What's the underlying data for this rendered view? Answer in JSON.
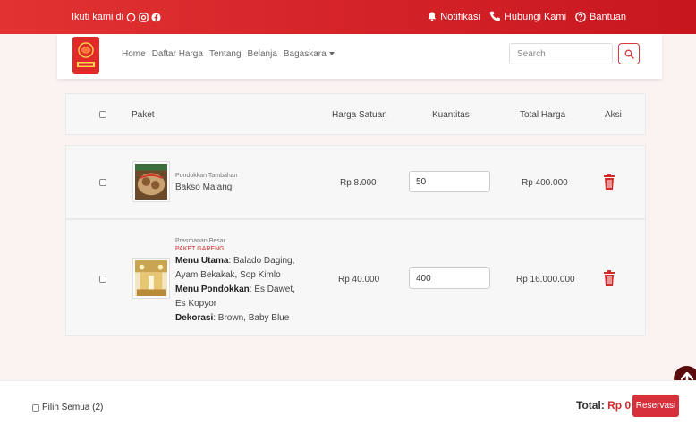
{
  "topbar": {
    "follow_text": "Ikuti kami di",
    "social_icons": [
      "whatsapp-icon",
      "instagram-icon",
      "facebook-icon"
    ],
    "notifications_label": "Notifikasi",
    "contact_label": "Hubungi Kami",
    "help_label": "Bantuan"
  },
  "navbar": {
    "logo_icon": "catering-logo",
    "links": [
      "Home",
      "Daftar Harga",
      "Tentang",
      "Belanja",
      "Bagaskara"
    ],
    "search_placeholder": "Search",
    "search_icon": "search-icon"
  },
  "table": {
    "headers": {
      "package": "Paket",
      "unit_price": "Harga Satuan",
      "quantity": "Kuantitas",
      "total_price": "Total Harga",
      "action": "Aksi"
    },
    "rows": [
      {
        "category": "Pondokkan Tambahan",
        "name": "Bakso Malang",
        "unit_price": "Rp 8.000",
        "quantity": "50",
        "total": "Rp 400.000",
        "selected": false
      },
      {
        "category": "Prasmanan Besar",
        "package_name": "PAKET GARENG",
        "menu_utama_label": "Menu Utama",
        "menu_utama": ": Balado Daging, Ayam Bekakak, Sop Kimlo",
        "menu_pondokkan_label": "Menu Pondokkan",
        "menu_pondokkan": ": Es Dawet, Es Kopyor",
        "dekorasi_label": "Dekorasi",
        "dekorasi": ": Brown, Baby Blue",
        "unit_price": "Rp 40.000",
        "quantity": "400",
        "total": "Rp 16.000.000",
        "selected": false
      }
    ]
  },
  "footer": {
    "select_all_label": "Pilih Semua (2)",
    "total_label": "Total:",
    "total_value": "Rp 0",
    "reserve_label": "Reservasi"
  },
  "colors": {
    "brand_red": "#d8303a",
    "topbar_red": "#e23232",
    "back_to_top": "#5a0b0b"
  }
}
